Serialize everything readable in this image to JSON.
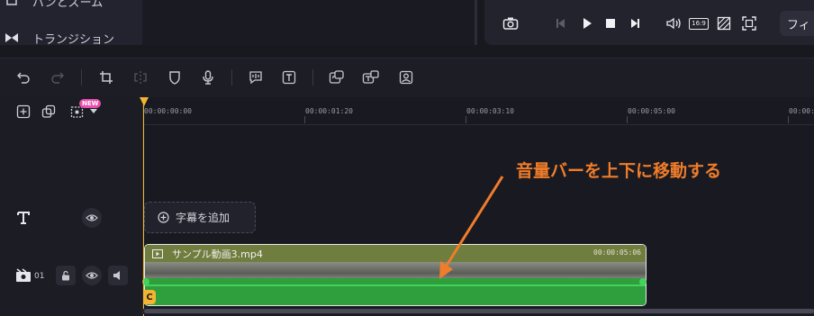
{
  "menu": {
    "item1": "パンとズーム",
    "item2": "トランジション"
  },
  "preview": {
    "fit_label": "フィ",
    "aspect_label": "16:9"
  },
  "ruler": {
    "ticks": [
      "00:00:00:00",
      "00:00:01:20",
      "00:00:03:10",
      "00:00:05:00",
      "00:00:0"
    ]
  },
  "track_header": {
    "new_badge": "NEW",
    "video_track_number": "01"
  },
  "subtitle": {
    "add_label": "字幕を追加"
  },
  "clip": {
    "name": "サンプル動画3.mp4",
    "duration": "00:00:05:06",
    "start_marker": "C"
  },
  "annotation": {
    "text": "音量バーを上下に移動する"
  },
  "colors": {
    "accent": "#f2b431",
    "annotation": "#f07d2a",
    "audio": "#2f9e3c",
    "volume_line": "#43d35a",
    "video_header": "#6f7d3e"
  }
}
